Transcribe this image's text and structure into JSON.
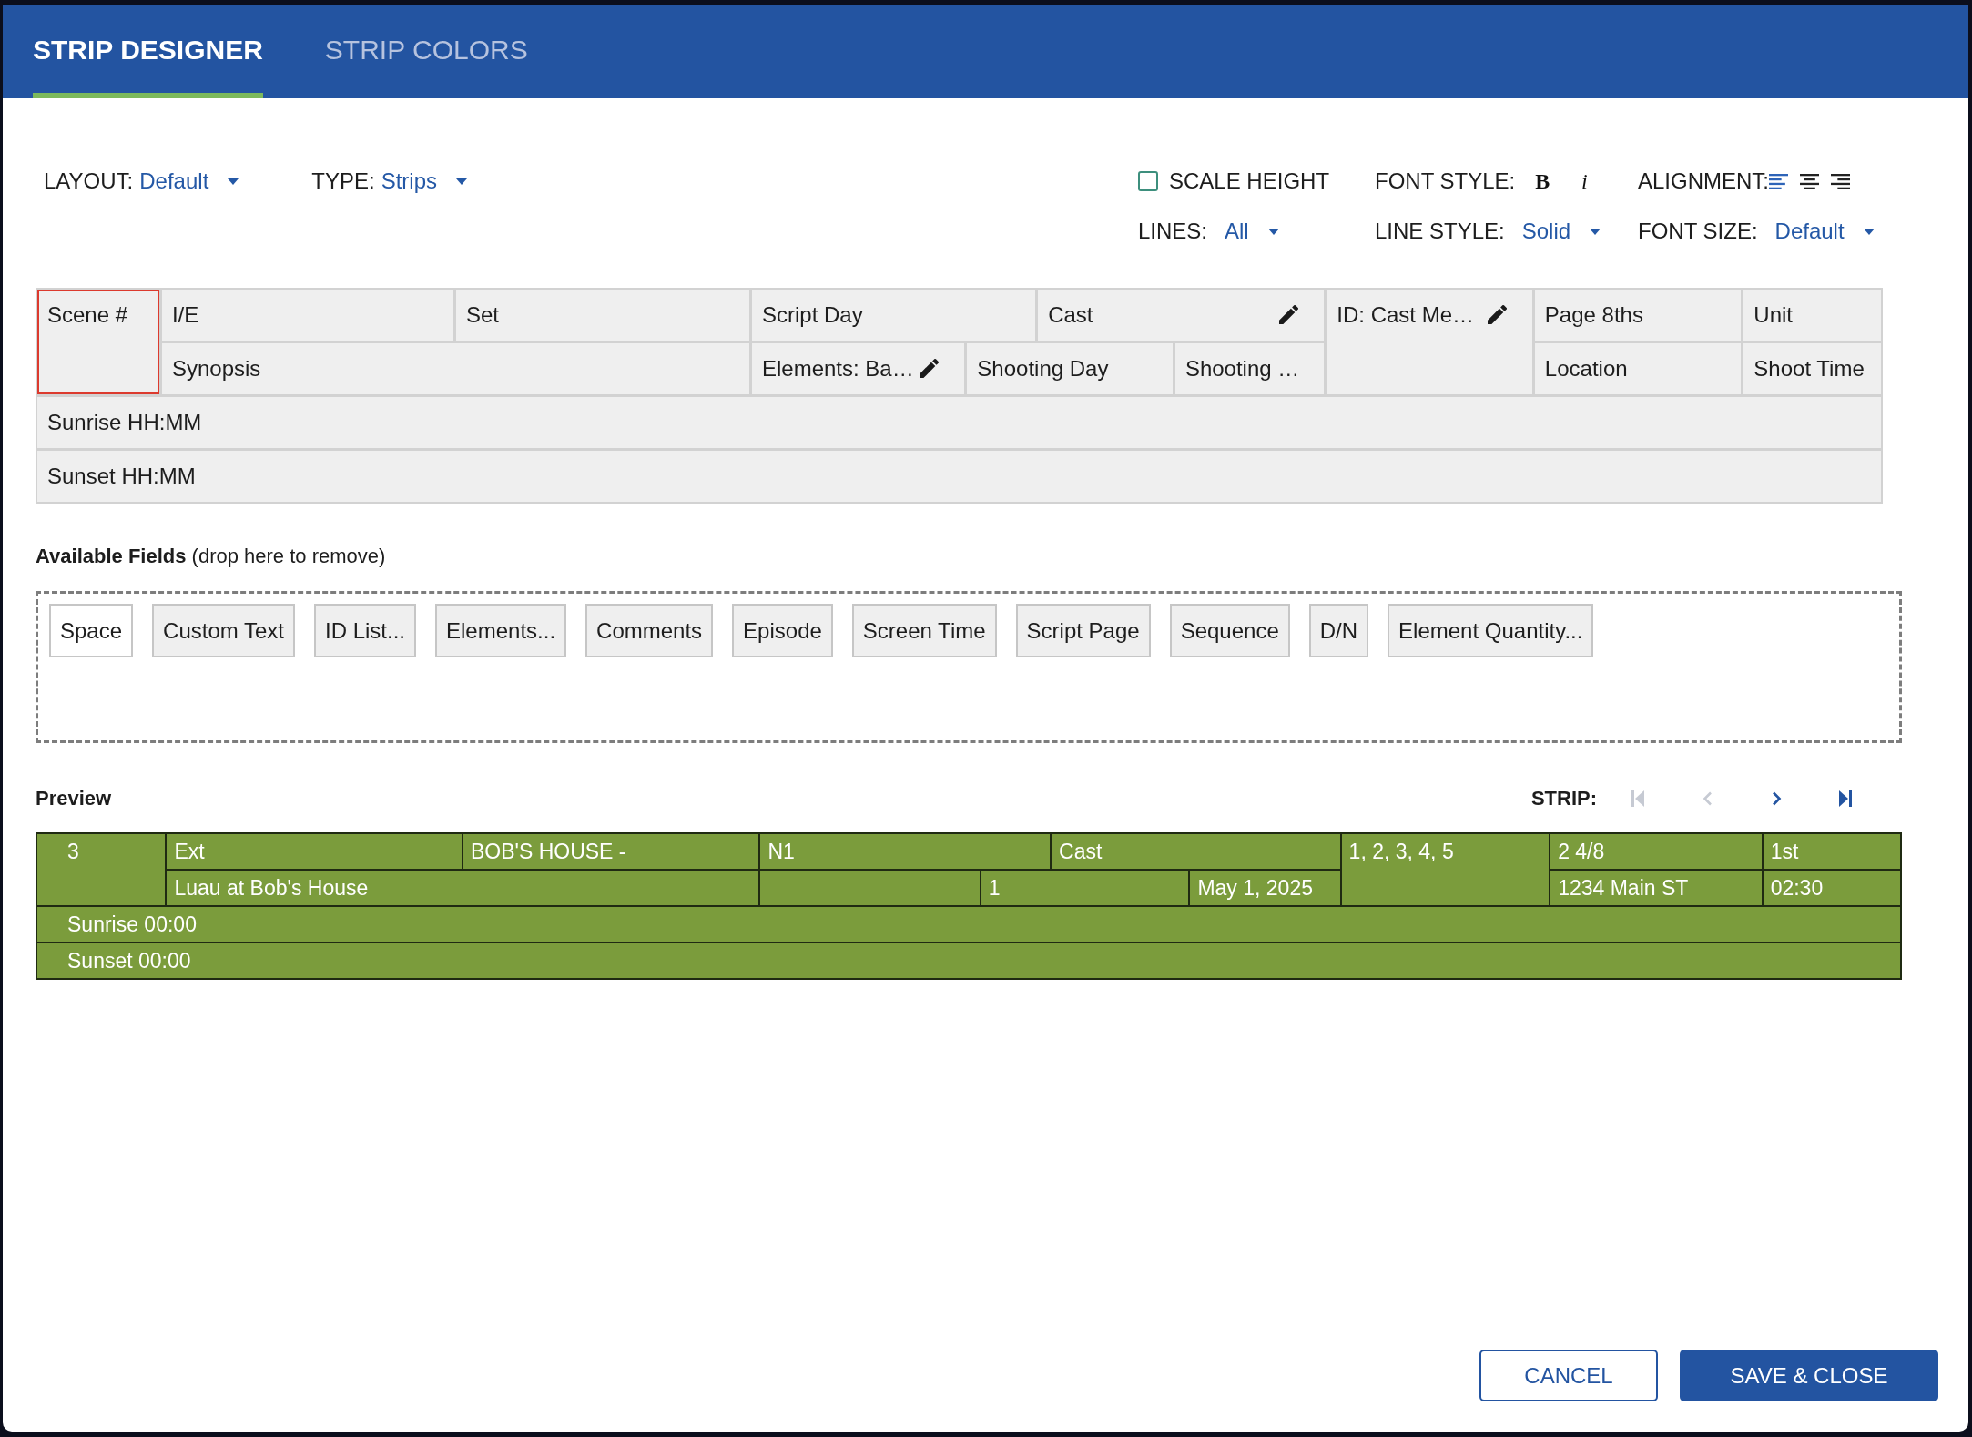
{
  "tabs": [
    {
      "label": "STRIP DESIGNER",
      "selected": true
    },
    {
      "label": "STRIP COLORS",
      "selected": false
    }
  ],
  "toolbar": {
    "layout": {
      "label": "LAYOUT:",
      "value": "Default"
    },
    "type": {
      "label": "TYPE:",
      "value": "Strips"
    },
    "scale_height": {
      "label": "SCALE HEIGHT",
      "checked": false
    },
    "font_style": {
      "label": "FONT STYLE:",
      "options": [
        {
          "kind": "bold",
          "label": "B"
        },
        {
          "kind": "italic",
          "label": "i"
        }
      ]
    },
    "alignment": {
      "label": "ALIGNMENT:",
      "options": [
        {
          "kind": "left",
          "selected": true
        },
        {
          "kind": "center",
          "selected": false
        },
        {
          "kind": "right",
          "selected": false
        }
      ]
    },
    "lines": {
      "label": "LINES:",
      "value": "All"
    },
    "line_style": {
      "label": "LINE STYLE:",
      "value": "Solid"
    },
    "font_size": {
      "label": "FONT SIZE:",
      "value": "Default"
    }
  },
  "strip_layout": {
    "fields": [
      {
        "label": "Scene #",
        "selected": true,
        "editable": false
      },
      {
        "label": "I/E",
        "selected": false,
        "editable": false
      },
      {
        "label": "Set",
        "selected": false,
        "editable": false
      },
      {
        "label": "Script Day",
        "selected": false,
        "editable": false
      },
      {
        "label": "Cast",
        "selected": false,
        "editable": true
      },
      {
        "label": "ID: Cast Me…",
        "selected": false,
        "editable": true
      },
      {
        "label": "Page 8ths",
        "selected": false,
        "editable": false
      },
      {
        "label": "Unit",
        "selected": false,
        "editable": false
      },
      {
        "label": "Synopsis",
        "selected": false,
        "editable": false
      },
      {
        "label": "Elements: Ba…",
        "selected": false,
        "editable": true
      },
      {
        "label": "Shooting Day",
        "selected": false,
        "editable": false
      },
      {
        "label": "Shooting …",
        "selected": false,
        "editable": false
      },
      {
        "label": "Location",
        "selected": false,
        "editable": false
      },
      {
        "label": "Shoot Time",
        "selected": false,
        "editable": false
      },
      {
        "label": "Sunrise HH:MM",
        "selected": false,
        "editable": false
      },
      {
        "label": "Sunset HH:MM",
        "selected": false,
        "editable": false
      }
    ]
  },
  "available_fields": {
    "title": "**Available Fields** (drop here to remove)",
    "fields": [
      {
        "label": "Space",
        "kind": "spacer"
      },
      {
        "label": "Custom Text",
        "kind": "field"
      },
      {
        "label": "ID List...",
        "kind": "field"
      },
      {
        "label": "Elements...",
        "kind": "field"
      },
      {
        "label": "Comments",
        "kind": "field"
      },
      {
        "label": "Episode",
        "kind": "field"
      },
      {
        "label": "Screen Time",
        "kind": "field"
      },
      {
        "label": "Script Page",
        "kind": "field"
      },
      {
        "label": "Sequence",
        "kind": "field"
      },
      {
        "label": "D/N",
        "kind": "field"
      },
      {
        "label": "Element Quantity...",
        "kind": "field"
      }
    ]
  },
  "preview": {
    "title": "Preview",
    "strip_label": "STRIP:",
    "navigation": [
      {
        "kind": "first",
        "disabled": true
      },
      {
        "kind": "previous",
        "disabled": true
      },
      {
        "kind": "next",
        "disabled": false
      },
      {
        "kind": "last",
        "disabled": false
      }
    ],
    "cells": [
      {
        "kind": "value",
        "text": "3"
      },
      {
        "kind": "value",
        "text": "Ext"
      },
      {
        "kind": "value",
        "text": "BOB'S HOUSE -"
      },
      {
        "kind": "value",
        "text": "N1"
      },
      {
        "kind": "value",
        "text": "Cast"
      },
      {
        "kind": "value",
        "text": "1, 2, 3, 4, 5"
      },
      {
        "kind": "value",
        "text": "2 4/8"
      },
      {
        "kind": "value",
        "text": "1st"
      },
      {
        "kind": "value",
        "text": "Luau at Bob's House"
      },
      {
        "kind": "blank"
      },
      {
        "kind": "value",
        "text": "1"
      },
      {
        "kind": "value",
        "text": "May 1, 2025"
      },
      {
        "kind": "value",
        "text": "1234 Main ST"
      },
      {
        "kind": "value",
        "text": "02:30"
      },
      {
        "kind": "value",
        "text": "Sunrise 00:00"
      },
      {
        "kind": "value",
        "text": "Sunset 00:00"
      }
    ]
  },
  "buttons": [
    {
      "label": "CANCEL",
      "kind": "secondary"
    },
    {
      "label": "SAVE & CLOSE",
      "kind": "primary"
    }
  ]
}
